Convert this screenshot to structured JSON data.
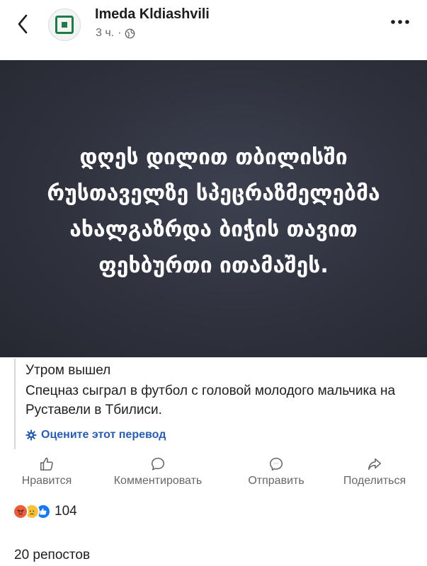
{
  "post": {
    "author": "Imeda Kldiashvili",
    "time": "3 ч.",
    "separator": "·",
    "image_text": "დღეს დილით თბილისში რუსთაველზე სპეცრაზმელებმა ახალგაზრდა ბიჭის თავით ფეხბურთი ითამაშეს.",
    "translation": {
      "title": "Утром вышел",
      "body": "Спецназ сыграл в футбол с головой молодого мальчика на Руставели в Тбилиси.",
      "rate_label": "Оцените этот перевод"
    },
    "actions": {
      "like": "Нравится",
      "comment": "Комментировать",
      "send": "Отправить",
      "share": "Поделиться"
    },
    "reactions_count": "104",
    "reposts": "20 репостов"
  },
  "colors": {
    "accent_link": "#2a5db0",
    "muted_text": "#65676b",
    "image_bg": "#2f323d",
    "brand_green": "#2e9e5b"
  },
  "icons": [
    "chevron-left-icon",
    "page-logo-icon",
    "globe-icon",
    "more-dots-icon",
    "gear-icon",
    "like-icon",
    "comment-icon",
    "messenger-icon",
    "share-icon",
    "angry-reaction-icon",
    "sad-reaction-icon",
    "like-reaction-icon"
  ]
}
